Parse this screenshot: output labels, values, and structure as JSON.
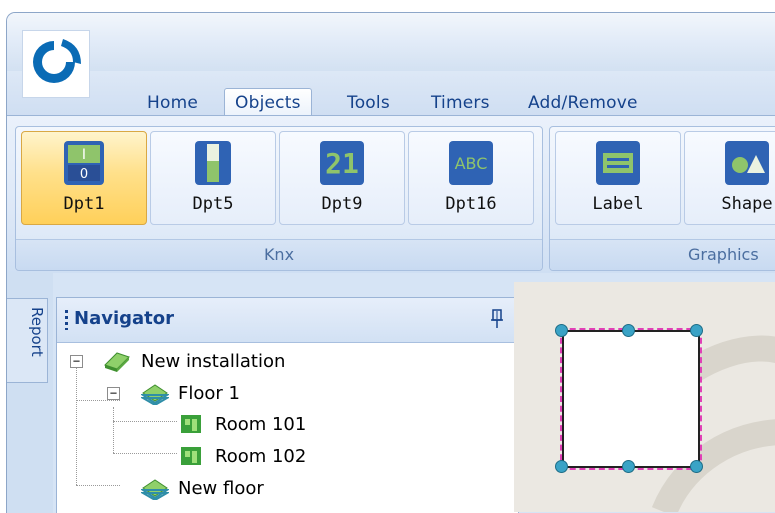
{
  "tabs": [
    {
      "label": "Home"
    },
    {
      "label": "Objects"
    },
    {
      "label": "Tools"
    },
    {
      "label": "Timers"
    },
    {
      "label": "Add/Remove"
    }
  ],
  "ribbon": {
    "knx_group": {
      "label": "Knx",
      "buttons": [
        {
          "label": "Dpt1",
          "icon": "switch-icon"
        },
        {
          "label": "Dpt5",
          "icon": "slider-icon"
        },
        {
          "label": "Dpt9",
          "icon": "numeric-display-icon"
        },
        {
          "label": "Dpt16",
          "icon": "text-display-icon"
        }
      ]
    },
    "graphics_group": {
      "label": "Graphics",
      "buttons": [
        {
          "label": "Label",
          "icon": "label-icon"
        },
        {
          "label": "Shape",
          "icon": "shape-icon"
        }
      ]
    }
  },
  "side_tab": {
    "label": "Report"
  },
  "navigator": {
    "title": "Navigator",
    "tree": [
      {
        "label": "New installation"
      },
      {
        "label": "Floor 1"
      },
      {
        "label": "Room 101"
      },
      {
        "label": "Room 102"
      },
      {
        "label": "New floor"
      }
    ]
  },
  "icons": {
    "dpt9_glyph": "21",
    "dpt16_glyph": "ABC",
    "dpt1_top": "I",
    "dpt1_bottom": "0"
  },
  "colors": {
    "accent": "#15428b",
    "selection_border": "#e03fb6",
    "handle": "#3aa3c6",
    "selected_button": "#ffd05a"
  }
}
